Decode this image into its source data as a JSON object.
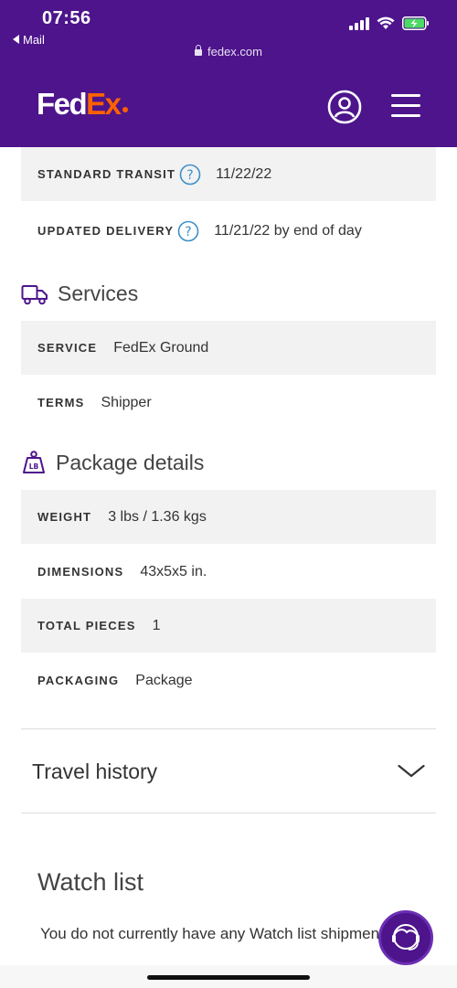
{
  "status_bar": {
    "time": "07:56",
    "back_app": "Mail"
  },
  "browser": {
    "url": "fedex.com"
  },
  "header": {
    "logo_part1": "Fed",
    "logo_part2": "Ex",
    "brand_color": "#4d148c",
    "accent_color": "#ff6200"
  },
  "delivery": {
    "standard_transit_label": "STANDARD TRANSIT",
    "standard_transit_value": "11/22/22",
    "updated_delivery_label": "UPDATED DELIVERY",
    "updated_delivery_value": "11/21/22 by end of day"
  },
  "services": {
    "title": "Services",
    "service_label": "SERVICE",
    "service_value": "FedEx Ground",
    "terms_label": "TERMS",
    "terms_value": "Shipper"
  },
  "package": {
    "title": "Package details",
    "weight_label": "WEIGHT",
    "weight_value": "3 lbs / 1.36 kgs",
    "dimensions_label": "DIMENSIONS",
    "dimensions_value": "43x5x5 in.",
    "total_pieces_label": "TOTAL PIECES",
    "total_pieces_value": "1",
    "packaging_label": "PACKAGING",
    "packaging_value": "Package"
  },
  "travel_history": {
    "title": "Travel history"
  },
  "watch_list": {
    "title": "Watch list",
    "message": "You do not currently have any Watch list shipments."
  }
}
